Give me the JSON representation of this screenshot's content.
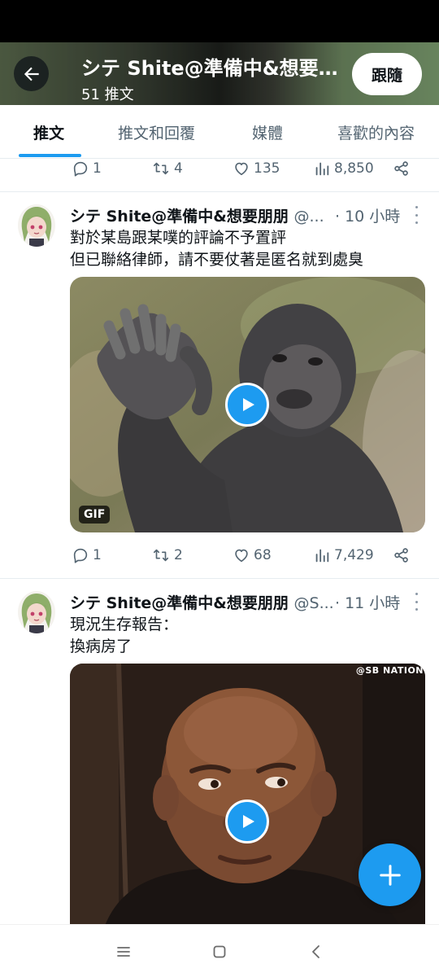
{
  "header": {
    "title": "シテ Shite@準備中&想要朋朋",
    "post_count": "51 推文",
    "follow_label": "跟隨"
  },
  "tabs": [
    {
      "label": "推文",
      "active": true
    },
    {
      "label": "推文和回覆",
      "active": false
    },
    {
      "label": "媒體",
      "active": false
    },
    {
      "label": "喜歡的內容",
      "active": false
    }
  ],
  "prev_tweet_actions": {
    "replies": "1",
    "retweets": "4",
    "likes": "135",
    "views": "8,850"
  },
  "tweets": [
    {
      "name": "シテ Shite@準備中&想要朋朋",
      "handle": "@...",
      "time": "· 10 小時",
      "lines": [
        "對於某島跟某噗的評論不予置評",
        "但已聯絡律師，請不要仗著是匿名就到處臭"
      ],
      "media_badge": "GIF",
      "actions": {
        "replies": "1",
        "retweets": "2",
        "likes": "68",
        "views": "7,429"
      }
    },
    {
      "name": "シテ Shite@準備中&想要朋朋",
      "handle": "@S...",
      "time": "· 11 小時",
      "lines": [
        "現況生存報告：",
        "換病房了"
      ],
      "media_watermark": "@SB NATION"
    }
  ],
  "colors": {
    "accent": "#1d9bf0",
    "text": "#0f1419",
    "muted": "#536471"
  },
  "icons": [
    "back-arrow-icon",
    "reply-icon",
    "retweet-icon",
    "like-icon",
    "views-icon",
    "share-icon",
    "play-icon",
    "more-icon",
    "compose-plus-icon",
    "nav-menu-icon",
    "nav-home-icon",
    "nav-back-icon"
  ]
}
